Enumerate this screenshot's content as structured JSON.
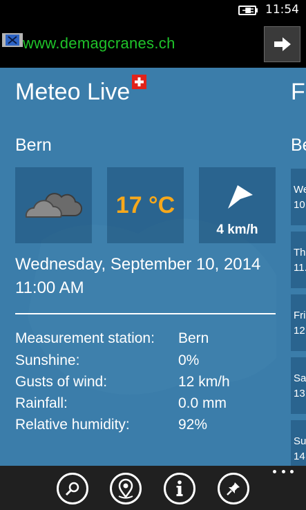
{
  "status_bar": {
    "time": "11:54",
    "battery_icon": "battery-charging-icon"
  },
  "ad": {
    "text": "www.demagcranes.ch",
    "go_icon": "arrow-right-icon",
    "close_icon": "close-icon"
  },
  "app": {
    "title": "Meteo Live",
    "flag_icon": "swiss-flag-icon",
    "next_panel_title": "Fo",
    "next_panel_city": "Be"
  },
  "current": {
    "city": "Bern",
    "weather_icon": "cloudy-icon",
    "temperature": "17 °C",
    "wind_icon": "wind-direction-arrow-icon",
    "wind_speed": "4 km/h",
    "date": "Wednesday, September 10, 2014",
    "time": "11:00 AM"
  },
  "details": [
    {
      "label": "Measurement station:",
      "value": "Bern"
    },
    {
      "label": "Sunshine:",
      "value": "0%"
    },
    {
      "label": "Gusts of wind:",
      "value": "12 km/h"
    },
    {
      "label": "Rainfall:",
      "value": "0.0 mm"
    },
    {
      "label": "Relative humidity:",
      "value": "92%"
    }
  ],
  "forecast_peek": [
    {
      "day": "We",
      "date": "10."
    },
    {
      "day": "Th",
      "date": "11."
    },
    {
      "day": "Fri",
      "date": "12."
    },
    {
      "day": "Sa",
      "date": "13."
    },
    {
      "day": "Su",
      "date": "14."
    }
  ],
  "app_bar": {
    "buttons": [
      "search-icon",
      "location-pin-icon",
      "info-icon",
      "pin-icon"
    ],
    "more_icon": "more-ellipsis-icon"
  },
  "colors": {
    "panel_bg": "#3b7daa",
    "temperature": "#f7a81b",
    "ad_text": "#1fc42a",
    "flag_red": "#e2231a"
  }
}
